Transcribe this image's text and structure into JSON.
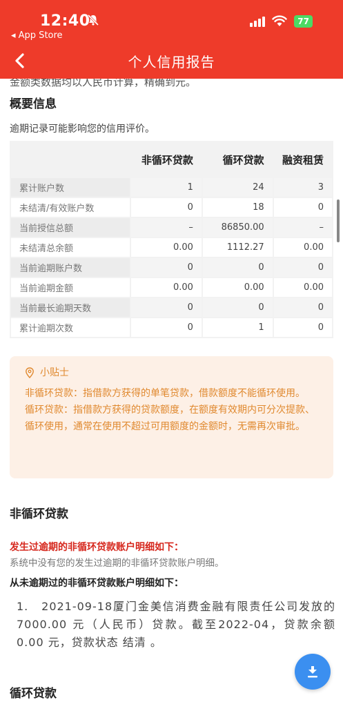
{
  "status": {
    "time": "12:40",
    "back_app": "◂ App Store",
    "battery": "77"
  },
  "nav": {
    "title": "个人信用报告"
  },
  "intro_cut": "金额类数据均以人民币计算，精确到元。",
  "summary": {
    "title": "概要信息",
    "hint": "逾期记录可能影响您的信用评价。",
    "columns": [
      "非循环贷款",
      "循环贷款",
      "融资租赁"
    ],
    "rows": [
      {
        "label": "累计账户数",
        "values": [
          "1",
          "24",
          "3"
        ]
      },
      {
        "label": "未结清/有效账户数",
        "values": [
          "0",
          "18",
          "0"
        ]
      },
      {
        "label": "当前授信总额",
        "values": [
          "–",
          "86850.00",
          "–"
        ]
      },
      {
        "label": "未结清总余额",
        "values": [
          "0.00",
          "1112.27",
          "0.00"
        ]
      },
      {
        "label": "当前逾期账户数",
        "values": [
          "0",
          "0",
          "0"
        ]
      },
      {
        "label": "当前逾期金额",
        "values": [
          "0.00",
          "0.00",
          "0.00"
        ]
      },
      {
        "label": "当前最长逾期天数",
        "values": [
          "0",
          "0",
          "0"
        ]
      },
      {
        "label": "累计逾期次数",
        "values": [
          "0",
          "1",
          "0"
        ]
      }
    ]
  },
  "tips": {
    "title": "小贴士",
    "p1": "非循环贷款：指借款方获得的单笔贷款，借款额度不能循环使用。",
    "p2": "循环贷款：指借款方获得的贷款额度，在额度有效期内可分次提款、循环使用，通常在使用不超过可用额度的金额时，无需再次审批。"
  },
  "non_revolving": {
    "title": "非循环贷款",
    "overdue_title": "发生过逾期的非循环贷款账户明细如下：",
    "overdue_empty": "系统中没有您的发生过逾期的非循环贷款账户明细。",
    "normal_title": "从未逾期过的非循环贷款账户明细如下：",
    "detail": "1.　2021-09-18厦门金美信消费金融有限责任公司发放的 7000.00 元（人民币）贷款。截至2022-04，贷款余额0.00 元，贷款状态 结清 。"
  },
  "revolving": {
    "title": "循环贷款"
  }
}
